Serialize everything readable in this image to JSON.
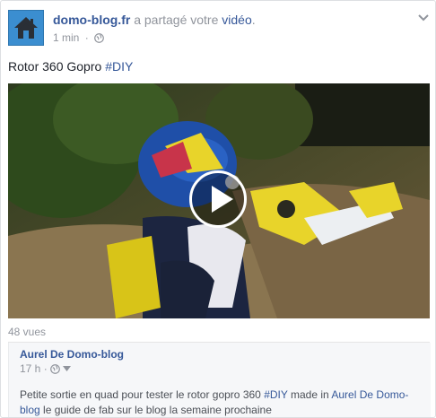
{
  "post": {
    "page_name": "domo-blog.fr",
    "action_text": "a partagé votre",
    "video_word": "vidéo",
    "period": ".",
    "time": "1 min",
    "dot": "·",
    "text": "Rotor 360 Gopro",
    "hashtag": "#DIY",
    "views": "48 vues"
  },
  "video": {
    "play_icon": "play-icon"
  },
  "original": {
    "author": "Aurel De Domo-blog",
    "time": "17 h",
    "dot": "·",
    "text_part1": "Petite sortie en quad pour tester le rotor gopro 360",
    "hashtag": "#DIY",
    "text_part2": "made in",
    "mention_line1": "Aurel De Domo-",
    "mention_line2": "blog",
    "text_part3": "le guide de fab sur le blog la semaine prochaine"
  },
  "colors": {
    "link": "#365899",
    "meta": "#90949c",
    "avatar": "#3b8ed0"
  }
}
